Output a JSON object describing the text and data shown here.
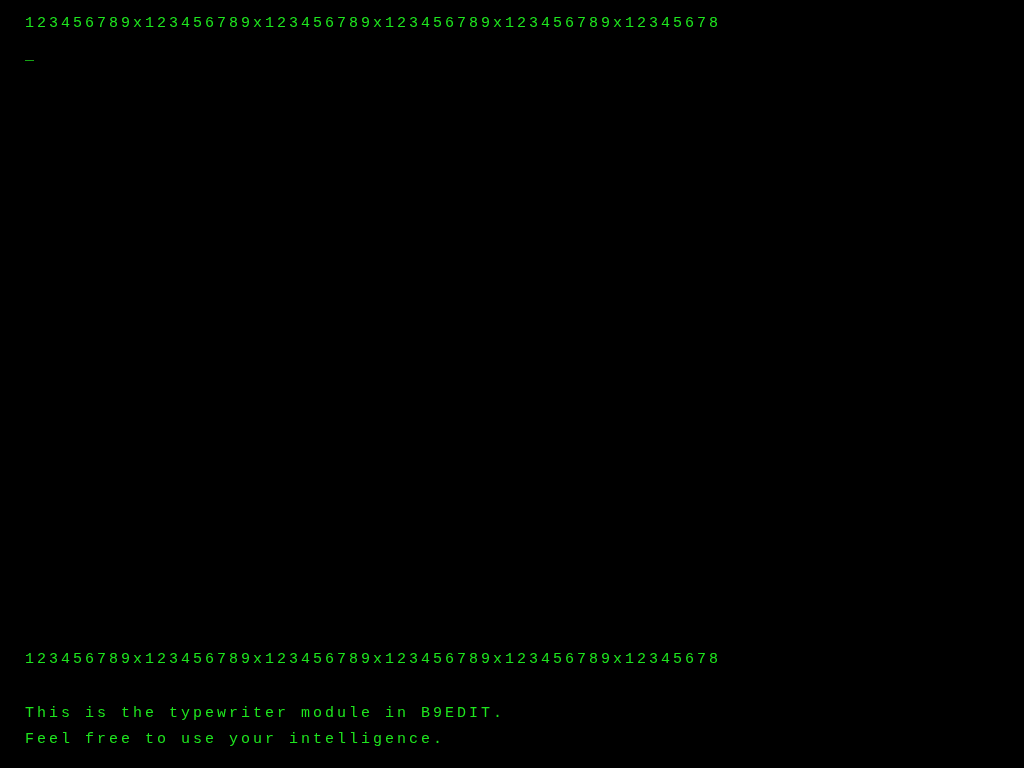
{
  "top_ruler": "123456789x123456789x123456789x123456789x123456789x12345678",
  "cursor": "_",
  "bottom_ruler": "123456789x123456789x123456789x123456789x123456789x12345678",
  "messages": [
    "This is the typewriter module in B9EDIT.",
    "Feel free to use your intelligence."
  ]
}
